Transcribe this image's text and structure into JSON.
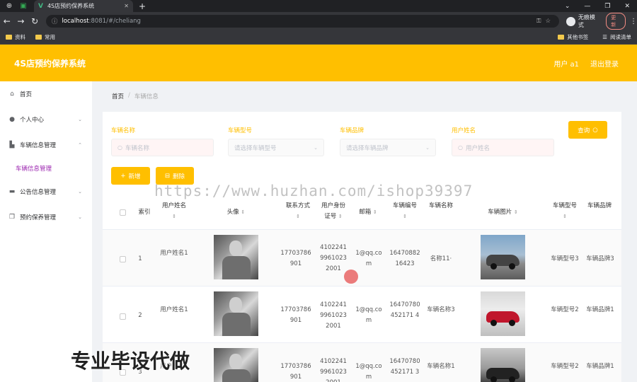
{
  "browser": {
    "tab_title": "4S店预约保养系统",
    "url_host": "localhost",
    "url_path": ":8081/#/cheliang",
    "incognito_label": "无痕模式",
    "update_label": "更新",
    "bookmarks": [
      "资料",
      "常用"
    ],
    "bookmarks_right": [
      "其他书签",
      "阅读清单"
    ]
  },
  "header": {
    "title": "4S店预约保养系统",
    "user": "用户 a1",
    "logout": "退出登录"
  },
  "sidebar": {
    "items": [
      {
        "label": "首页",
        "icon": "home-icon"
      },
      {
        "label": "个人中心",
        "icon": "user-icon"
      },
      {
        "label": "车辆信息管理",
        "icon": "car-icon"
      },
      {
        "label": "公告信息管理",
        "icon": "monitor-icon"
      },
      {
        "label": "预约保养管理",
        "icon": "copy-icon"
      }
    ],
    "subitem": "车辆信息管理"
  },
  "breadcrumb": {
    "home": "首页",
    "sep": "/",
    "current": "车辆信息"
  },
  "filters": {
    "vehicle_name": {
      "label": "车辆名称",
      "placeholder": "车辆名称"
    },
    "vehicle_model": {
      "label": "车辆型号",
      "placeholder": "请选择车辆型号"
    },
    "vehicle_brand": {
      "label": "车辆品牌",
      "placeholder": "请选择车辆品牌"
    },
    "user_name": {
      "label": "用户姓名",
      "placeholder": "用户姓名"
    },
    "query_button": "查询"
  },
  "actions": {
    "add": "新增",
    "delete": "删除"
  },
  "table": {
    "headers": {
      "index": "索引",
      "user_name": "用户姓名",
      "avatar": "头像",
      "phone": "联系方式",
      "id_card": "用户身份证号",
      "email": "邮箱",
      "vehicle_no": "车辆编号",
      "vehicle_name": "车辆名称",
      "vehicle_img": "车辆图片",
      "vehicle_model": "车辆型号",
      "vehicle_brand": "车辆品牌"
    },
    "rows": [
      {
        "index": "1",
        "user_name": "用户姓名1",
        "phone": "17703786901",
        "id_card": "410224199610232001",
        "email": "1@qq.com",
        "vehicle_no": "1647088216423",
        "vehicle_name": "名称11·",
        "vehicle_model": "车辆型号3",
        "vehicle_brand": "车辆品牌3"
      },
      {
        "index": "2",
        "user_name": "用户姓名1",
        "phone": "17703786901",
        "id_card": "410224199610232001",
        "email": "1@qq.com",
        "vehicle_no": "16470780452171 4",
        "vehicle_name": "车辆名称3",
        "vehicle_model": "车辆型号2",
        "vehicle_brand": "车辆品牌1"
      },
      {
        "index": "3",
        "user_name": "用户姓名1",
        "phone": "17703786901",
        "id_card": "410224199610232001",
        "email": "1@qq.com",
        "vehicle_no": "16470780452171 3",
        "vehicle_name": "车辆名称1",
        "vehicle_model": "车辆型号2",
        "vehicle_brand": "车辆品牌1"
      }
    ]
  },
  "overlay": {
    "watermark": "https://www.huzhan.com/ishop39397",
    "promo": "专业毕设代做"
  }
}
